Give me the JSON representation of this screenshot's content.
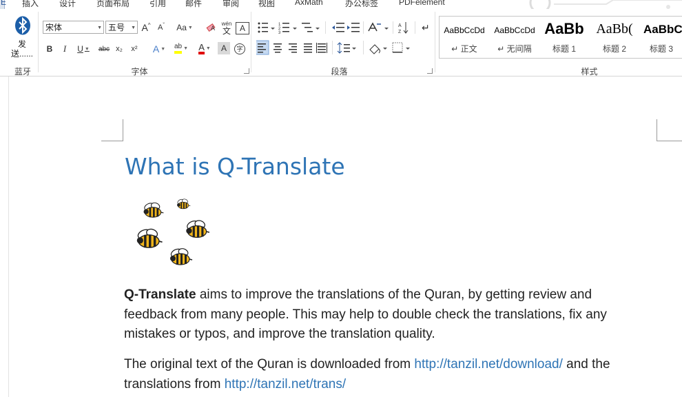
{
  "ribbon_tabs": [
    {
      "label": "插入"
    },
    {
      "label": "设计"
    },
    {
      "label": "页面布局"
    },
    {
      "label": "引用"
    },
    {
      "label": "邮件"
    },
    {
      "label": "审阅"
    },
    {
      "label": "视图"
    },
    {
      "label": "AxMath"
    },
    {
      "label": "办公标签"
    },
    {
      "label": "PDFelement"
    }
  ],
  "active_tab_edge": "E",
  "bluetooth": {
    "label_line1": "发",
    "label_line2": "送......",
    "group": "蓝牙"
  },
  "font_group": {
    "font_name": "宋体",
    "font_size": "五号",
    "change_case": "Aa",
    "pinyin_top": "wén",
    "pinyin_char": "文",
    "enclosed_char": "A",
    "bold": "B",
    "italic": "I",
    "underline": "U",
    "strikethrough": "abc",
    "subscript": "x₂",
    "superscript": "x²",
    "effects": "A",
    "highlight": "ab",
    "font_color": "A",
    "char_shading": "A",
    "enclose_char": "字",
    "label": "字体"
  },
  "paragraph_group": {
    "label": "段落"
  },
  "styles_group": {
    "label": "样式",
    "items": [
      {
        "preview": "AaBbCcDd",
        "name": "↵ 正文"
      },
      {
        "preview": "AaBbCcDd",
        "name": "↵ 无间隔"
      },
      {
        "preview": "AaBb",
        "name": "标题 1"
      },
      {
        "preview": "AaBb(",
        "name": "标题 2"
      },
      {
        "preview": "AaBbC",
        "name": "标题 3"
      }
    ]
  },
  "document": {
    "heading": "What is Q-Translate",
    "p1_bold": "Q-Translate",
    "p1_line1": " aims to improve the translations of the Quran, by getting review and",
    "p1_line2": "feedback from many people. This may help to double check the translations, fix any",
    "p1_line3": "mistakes or typos, and improve the translation quality.",
    "p2_text1": "The original text of the Quran is downloaded from ",
    "p2_link1": "http://tanzil.net/download/",
    "p2_text2": " and the",
    "p2_text3": "translations from ",
    "p2_link2": "http://tanzil.net/trans/"
  },
  "colors": {
    "accent": "#2e74b5",
    "highlight": "#ffff00",
    "font_color": "#e00000"
  }
}
